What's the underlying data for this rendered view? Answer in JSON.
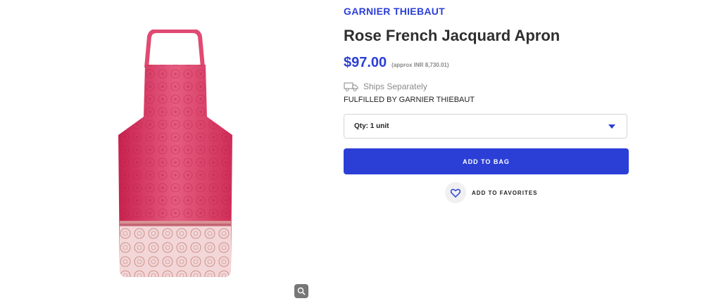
{
  "product": {
    "brand": "GARNIER THIEBAUT",
    "title": "Rose French Jacquard Apron",
    "price": "$97.00",
    "approx_price": "(approx INR 8,730.01)",
    "shipping_label": "Ships Separately",
    "fulfilled_by": "FULFILLED BY GARNIER THIEBAUT"
  },
  "quantity": {
    "selected": "Qty: 1 unit"
  },
  "actions": {
    "add_to_bag": "ADD TO BAG",
    "add_to_favorites": "ADD TO FAVORITES"
  },
  "icons": {
    "zoom": "magnifier-icon",
    "shipping": "truck-icon",
    "favorite": "heart-icon",
    "dropdown": "chevron-down-icon"
  },
  "colors": {
    "accent": "#2b3fd6",
    "apron_main": "#e04a72",
    "apron_border": "#f3d7d9"
  }
}
